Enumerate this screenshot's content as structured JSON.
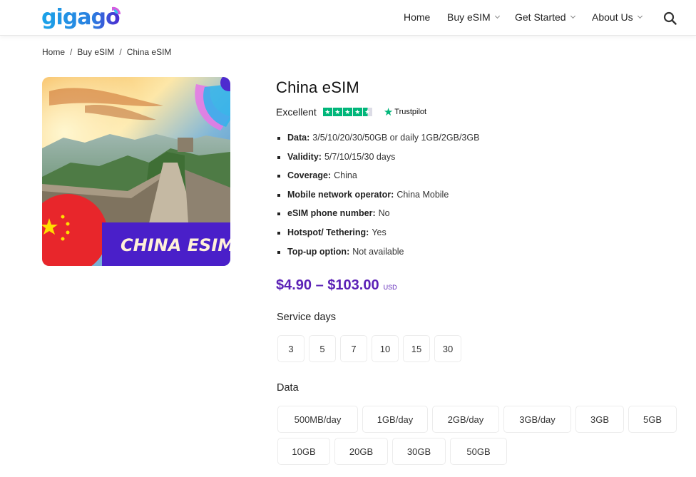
{
  "header": {
    "logo_text": "gigago",
    "nav": [
      {
        "label": "Home",
        "dropdown": false
      },
      {
        "label": "Buy eSIM",
        "dropdown": true
      },
      {
        "label": "Get Started",
        "dropdown": true
      },
      {
        "label": "About Us",
        "dropdown": true
      }
    ],
    "search_icon": "search-icon"
  },
  "breadcrumb": {
    "items": [
      "Home",
      "Buy eSIM",
      "China eSIM"
    ],
    "separator": "/"
  },
  "product": {
    "image_caption": "CHINA ESIM",
    "title": "China eSIM",
    "rating": {
      "label": "Excellent",
      "stars": 4.5,
      "max_stars": 5,
      "provider": "Trustpilot"
    },
    "features": [
      {
        "label": "Data:",
        "value": "3/5/10/20/30/50GB or daily 1GB/2GB/3GB"
      },
      {
        "label": "Validity:",
        "value": "5/7/10/15/30 days"
      },
      {
        "label": "Coverage:",
        "value": "China"
      },
      {
        "label": "Mobile network operator:",
        "value": "China Mobile"
      },
      {
        "label": "eSIM phone number:",
        "value": "No"
      },
      {
        "label": "Hotspot/ Tethering:",
        "value": "Yes"
      },
      {
        "label": "Top-up option:",
        "value": "Not available"
      }
    ],
    "price": {
      "range": "$4.90 – $103.00",
      "currency": "USD"
    },
    "service_days": {
      "label": "Service days",
      "options": [
        "3",
        "5",
        "7",
        "10",
        "15",
        "30"
      ]
    },
    "data_options": {
      "label": "Data",
      "options": [
        "500MB/day",
        "1GB/day",
        "2GB/day",
        "3GB/day",
        "3GB",
        "5GB",
        "10GB",
        "20GB",
        "30GB",
        "50GB"
      ]
    }
  },
  "colors": {
    "brand_blue": "#1e9be6",
    "brand_purple": "#5b21b6",
    "trustpilot_green": "#00b67a"
  }
}
